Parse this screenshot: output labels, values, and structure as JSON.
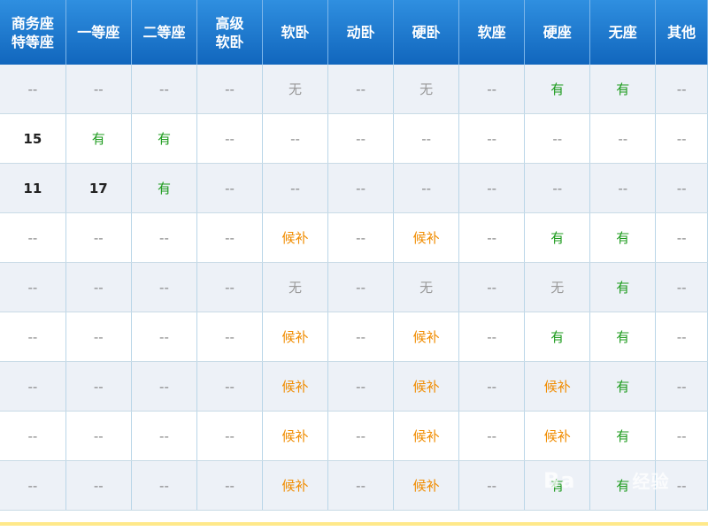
{
  "headers": [
    "商务座\n特等座",
    "一等座",
    "二等座",
    "高级\n软卧",
    "软卧",
    "动卧",
    "硬卧",
    "软座",
    "硬座",
    "无座",
    "其他"
  ],
  "rows": [
    [
      "--",
      "--",
      "--",
      "--",
      "无",
      "--",
      "无",
      "--",
      "有",
      "有",
      "--"
    ],
    [
      "15",
      "有",
      "有",
      "--",
      "--",
      "--",
      "--",
      "--",
      "--",
      "--",
      "--"
    ],
    [
      "11",
      "17",
      "有",
      "--",
      "--",
      "--",
      "--",
      "--",
      "--",
      "--",
      "--"
    ],
    [
      "--",
      "--",
      "--",
      "--",
      "候补",
      "--",
      "候补",
      "--",
      "有",
      "有",
      "--"
    ],
    [
      "--",
      "--",
      "--",
      "--",
      "无",
      "--",
      "无",
      "--",
      "无",
      "有",
      "--"
    ],
    [
      "--",
      "--",
      "--",
      "--",
      "候补",
      "--",
      "候补",
      "--",
      "有",
      "有",
      "--"
    ],
    [
      "--",
      "--",
      "--",
      "--",
      "候补",
      "--",
      "候补",
      "--",
      "候补",
      "有",
      "--"
    ],
    [
      "--",
      "--",
      "--",
      "--",
      "候补",
      "--",
      "候补",
      "--",
      "候补",
      "有",
      "--"
    ],
    [
      "--",
      "--",
      "--",
      "--",
      "候补",
      "--",
      "候补",
      "--",
      "有",
      "有",
      "--"
    ]
  ],
  "watermark": {
    "brand": "Ba",
    "label": "经验"
  },
  "colors": {
    "header_bg": "#1a76cf",
    "available": "#1d9b1d",
    "waitlist": "#f08c00",
    "none": "#999999",
    "row_alt": "#edf1f7"
  }
}
